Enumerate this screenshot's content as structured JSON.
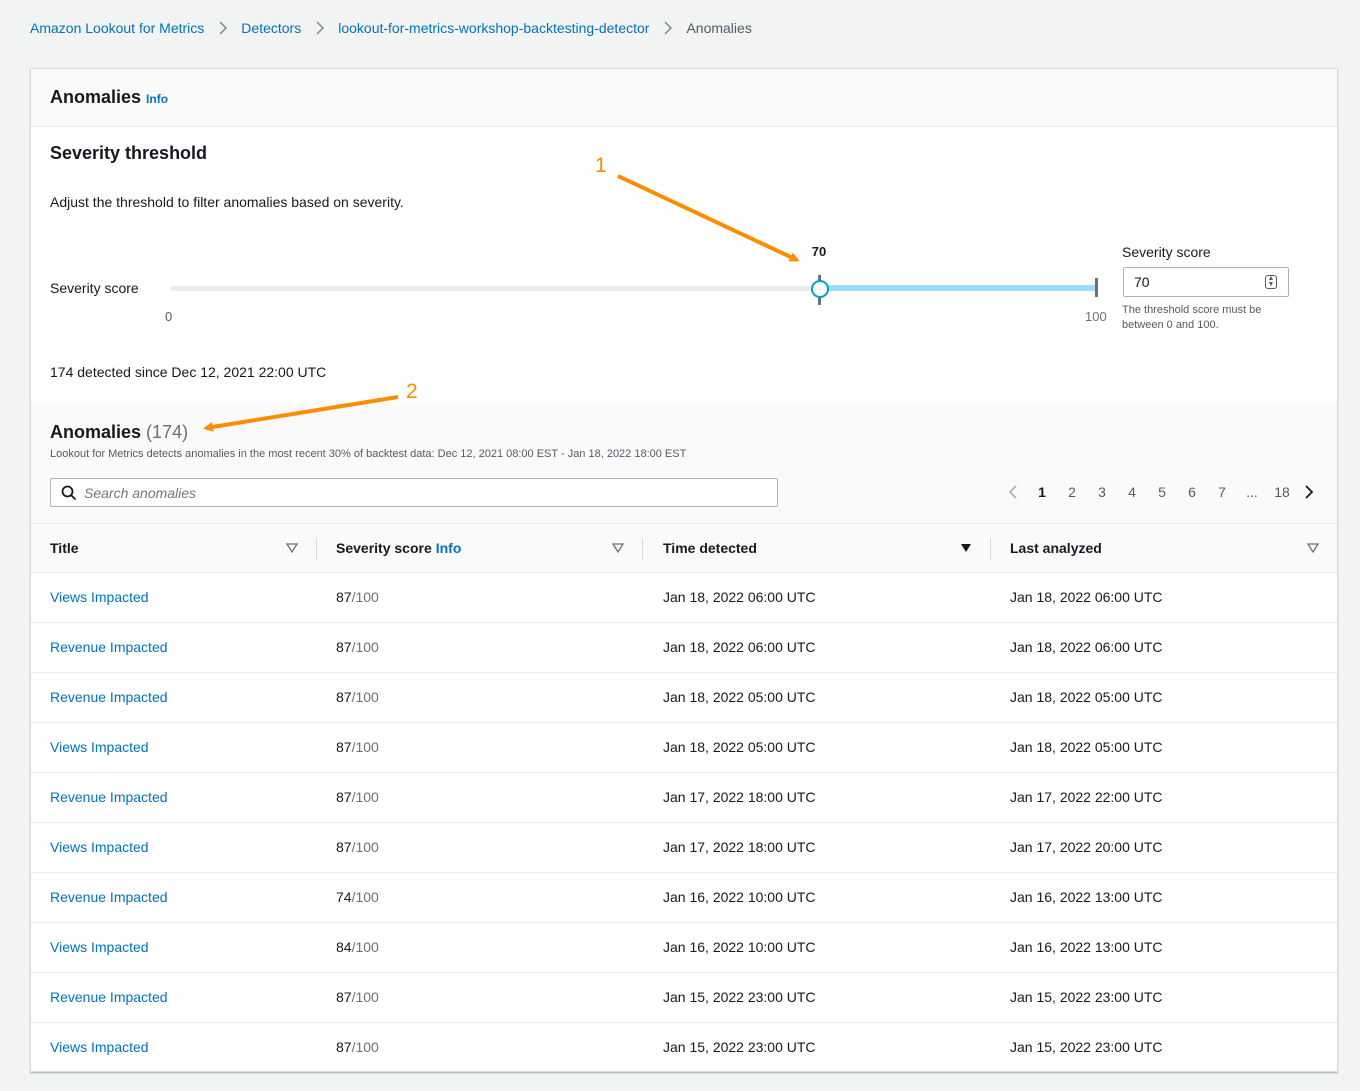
{
  "breadcrumb": [
    {
      "label": "Amazon Lookout for Metrics"
    },
    {
      "label": "Detectors"
    },
    {
      "label": "lookout-for-metrics-workshop-backtesting-detector"
    },
    {
      "label": "Anomalies"
    }
  ],
  "header": {
    "title": "Anomalies",
    "info": "Info"
  },
  "severity": {
    "title": "Severity threshold",
    "description": "Adjust the threshold to filter anomalies based on severity.",
    "slider_label": "Severity score",
    "value": "70",
    "min": "0",
    "max": "100",
    "input_label": "Severity score",
    "input_value": "70",
    "hint": "The threshold score must be between 0 and 100."
  },
  "summary": "174 detected since Dec 12, 2021 22:00 UTC",
  "table": {
    "title": "Anomalies",
    "count": "(174)",
    "description": "Lookout for Metrics detects anomalies in the most recent 30% of backtest data: Dec 12, 2021 08:00 EST - Jan 18, 2022 18:00 EST",
    "search_placeholder": "Search anomalies",
    "pagination": {
      "pages": [
        "1",
        "2",
        "3",
        "4",
        "5",
        "6",
        "7",
        "...",
        "18"
      ],
      "current": "1"
    },
    "columns": {
      "title": "Title",
      "score": "Severity score",
      "score_info": "Info",
      "time": "Time detected",
      "last": "Last analyzed"
    },
    "score_max": "/100",
    "rows": [
      {
        "title": "Views Impacted",
        "score": "87",
        "time": "Jan 18, 2022 06:00 UTC",
        "last": "Jan 18, 2022 06:00 UTC"
      },
      {
        "title": "Revenue Impacted",
        "score": "87",
        "time": "Jan 18, 2022 06:00 UTC",
        "last": "Jan 18, 2022 06:00 UTC"
      },
      {
        "title": "Revenue Impacted",
        "score": "87",
        "time": "Jan 18, 2022 05:00 UTC",
        "last": "Jan 18, 2022 05:00 UTC"
      },
      {
        "title": "Views Impacted",
        "score": "87",
        "time": "Jan 18, 2022 05:00 UTC",
        "last": "Jan 18, 2022 05:00 UTC"
      },
      {
        "title": "Revenue Impacted",
        "score": "87",
        "time": "Jan 17, 2022 18:00 UTC",
        "last": "Jan 17, 2022 22:00 UTC"
      },
      {
        "title": "Views Impacted",
        "score": "87",
        "time": "Jan 17, 2022 18:00 UTC",
        "last": "Jan 17, 2022 20:00 UTC"
      },
      {
        "title": "Revenue Impacted",
        "score": "74",
        "time": "Jan 16, 2022 10:00 UTC",
        "last": "Jan 16, 2022 13:00 UTC"
      },
      {
        "title": "Views Impacted",
        "score": "84",
        "time": "Jan 16, 2022 10:00 UTC",
        "last": "Jan 16, 2022 13:00 UTC"
      },
      {
        "title": "Revenue Impacted",
        "score": "87",
        "time": "Jan 15, 2022 23:00 UTC",
        "last": "Jan 15, 2022 23:00 UTC"
      },
      {
        "title": "Views Impacted",
        "score": "87",
        "time": "Jan 15, 2022 23:00 UTC",
        "last": "Jan 15, 2022 23:00 UTC"
      }
    ]
  },
  "annotations": [
    "1",
    "2"
  ],
  "colors": {
    "link": "#0073bb",
    "annotation": "#ff8c00",
    "slider_fill": "#99e0ff",
    "slider_thumb": "#00a1c9"
  }
}
